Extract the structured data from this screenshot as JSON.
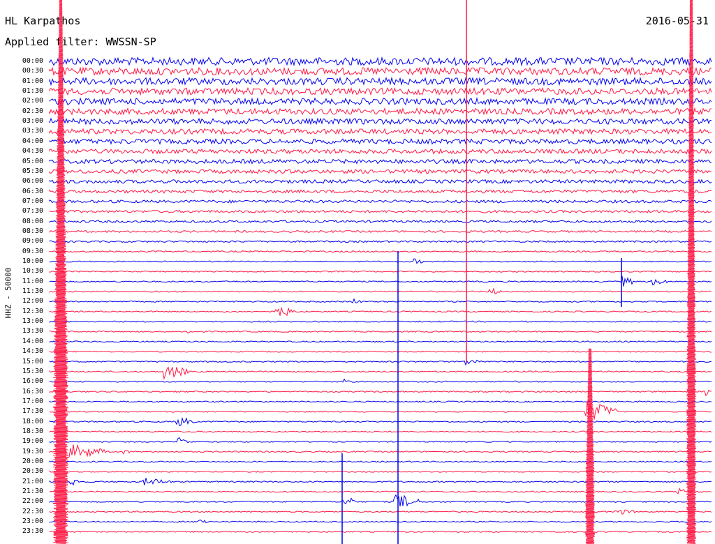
{
  "header": {
    "station": "HL Karpathos",
    "filter": "Applied filter: WWSSN-SP",
    "date": "2016-05-31"
  },
  "channel_label": "HHZ - 50000",
  "colors": {
    "trace_a": "#0000ee",
    "trace_b": "#ff1744"
  },
  "rows": [
    "00:00",
    "00:30",
    "01:00",
    "01:30",
    "02:00",
    "02:30",
    "03:00",
    "03:30",
    "04:00",
    "04:30",
    "05:00",
    "05:30",
    "06:00",
    "06:30",
    "07:00",
    "07:30",
    "08:00",
    "08:30",
    "09:00",
    "09:30",
    "10:00",
    "10:30",
    "11:00",
    "11:30",
    "12:00",
    "12:30",
    "13:00",
    "13:30",
    "14:00",
    "14:30",
    "15:00",
    "15:30",
    "16:00",
    "16:30",
    "17:00",
    "17:30",
    "18:00",
    "18:30",
    "19:00",
    "19:30",
    "20:00",
    "20:30",
    "21:00",
    "21:30",
    "22:00",
    "22:30",
    "23:00",
    "23:30"
  ]
}
